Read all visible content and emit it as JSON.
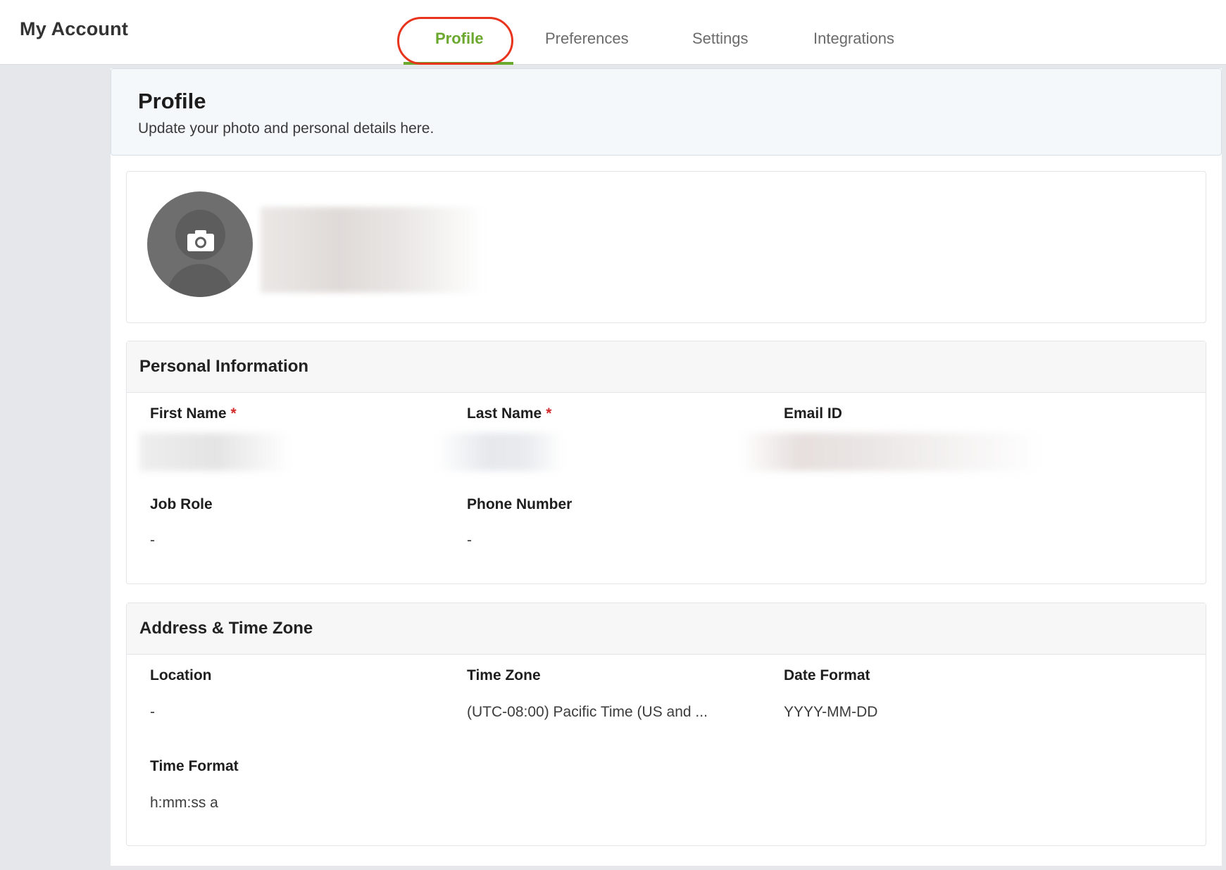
{
  "header": {
    "app_title": "My Account",
    "tabs": [
      {
        "label": "Profile",
        "active": true
      },
      {
        "label": "Preferences",
        "active": false
      },
      {
        "label": "Settings",
        "active": false
      },
      {
        "label": "Integrations",
        "active": false
      }
    ]
  },
  "page": {
    "title": "Profile",
    "subtitle": "Update your photo and personal details here."
  },
  "avatar": {
    "icon": "camera-icon"
  },
  "personal_info": {
    "title": "Personal Information",
    "first_name": {
      "label": "First Name",
      "required_mark": "*",
      "value": ""
    },
    "last_name": {
      "label": "Last Name",
      "required_mark": "*",
      "value": ""
    },
    "email": {
      "label": "Email ID",
      "value": ""
    },
    "job_role": {
      "label": "Job Role",
      "value": "-"
    },
    "phone": {
      "label": "Phone Number",
      "value": "-"
    }
  },
  "address": {
    "title": "Address & Time Zone",
    "location": {
      "label": "Location",
      "value": "-"
    },
    "time_zone": {
      "label": "Time Zone",
      "value": "(UTC-08:00) Pacific Time (US and ..."
    },
    "date_format": {
      "label": "Date Format",
      "value": "YYYY-MM-DD"
    },
    "time_format": {
      "label": "Time Format",
      "value": "h:mm:ss a"
    }
  },
  "colors": {
    "accent": "#6aa82e",
    "highlight": "#e8341c",
    "required": "#d22b2b"
  }
}
